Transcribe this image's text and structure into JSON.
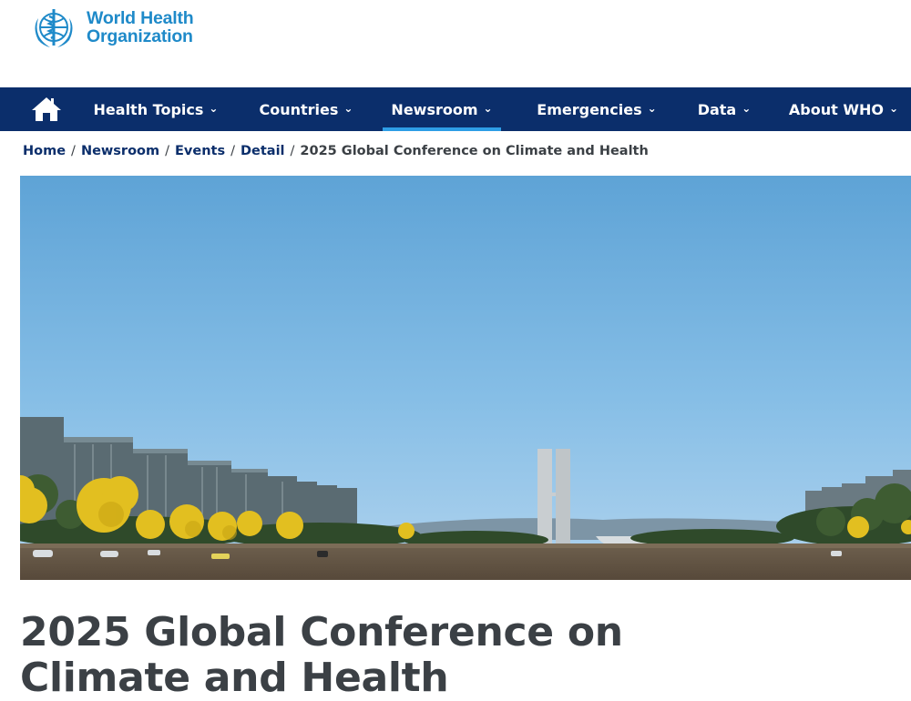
{
  "header": {
    "logo": {
      "line1": "World Health",
      "line2": "Organization",
      "brand_color": "#1f8ac9",
      "icon": "who-emblem-icon"
    }
  },
  "nav": {
    "background": "#0b2e6b",
    "home_icon": "home-icon",
    "items": [
      {
        "label": "Health Topics",
        "active": false
      },
      {
        "label": "Countries",
        "active": false
      },
      {
        "label": "Newsroom",
        "active": true
      },
      {
        "label": "Emergencies",
        "active": false
      },
      {
        "label": "Data",
        "active": false
      },
      {
        "label": "About WHO",
        "active": false
      }
    ],
    "chevron": "⌄"
  },
  "breadcrumb": {
    "items": [
      "Home",
      "Newsroom",
      "Events",
      "Detail"
    ],
    "separator": "/",
    "current": "2025 Global Conference on Climate and Health"
  },
  "hero": {
    "image": "brasilia-esplanada-photo"
  },
  "page": {
    "title": "2025 Global Conference on Climate and Health"
  }
}
